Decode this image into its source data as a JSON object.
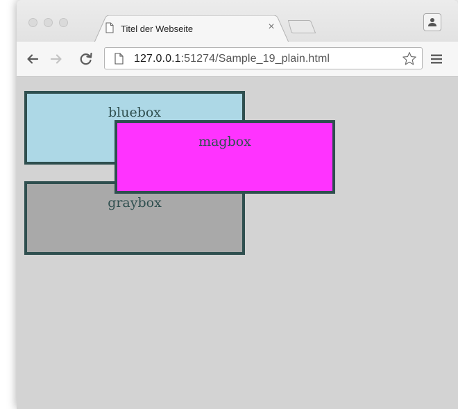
{
  "browser": {
    "tab": {
      "title": "Titel der Webseite",
      "close_glyph": "×"
    },
    "address_bar": {
      "host": "127.0.0.1",
      "rest": ":51274/Sample_19_plain.html"
    },
    "icons": [
      "back-arrow-icon",
      "forward-arrow-icon",
      "reload-icon",
      "page-icon",
      "star-icon",
      "menu-icon",
      "profile-icon"
    ]
  },
  "page": {
    "background": "#d3d3d3",
    "boxes": {
      "bluebox": {
        "label": "bluebox",
        "color": "#add8e6"
      },
      "magbox": {
        "label": "magbox",
        "color": "#ff33ff"
      },
      "graybox": {
        "label": "graybox",
        "color": "#a9a9a9"
      }
    },
    "border_color": "#2f4f4f"
  }
}
